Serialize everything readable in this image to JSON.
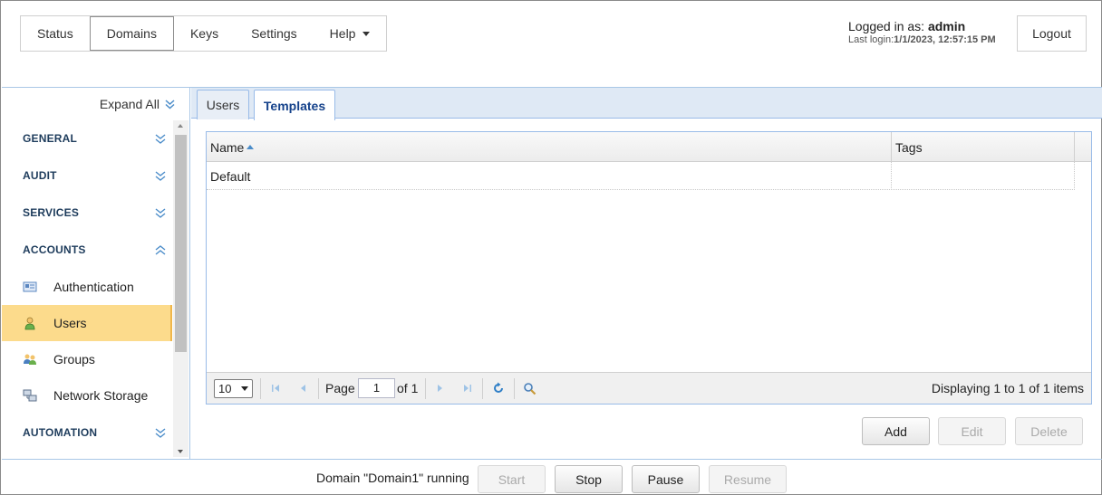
{
  "topnav": {
    "items": [
      {
        "label": "Status"
      },
      {
        "label": "Domains"
      },
      {
        "label": "Keys"
      },
      {
        "label": "Settings"
      },
      {
        "label": "Help"
      }
    ]
  },
  "login": {
    "prefix": "Logged in as: ",
    "user": "admin",
    "last_prefix": "Last login:",
    "last_value": "1/1/2023, 12:57:15 PM",
    "logout_label": "Logout"
  },
  "sidebar": {
    "expand_all": "Expand All",
    "sections": [
      {
        "label": "GENERAL",
        "state": "collapsed"
      },
      {
        "label": "AUDIT",
        "state": "collapsed"
      },
      {
        "label": "SERVICES",
        "state": "collapsed"
      },
      {
        "label": "ACCOUNTS",
        "state": "expanded"
      },
      {
        "label": "AUTOMATION",
        "state": "collapsed"
      }
    ],
    "items": [
      {
        "label": "Authentication",
        "icon": "authentication-icon"
      },
      {
        "label": "Users",
        "icon": "user-icon"
      },
      {
        "label": "Groups",
        "icon": "groups-icon"
      },
      {
        "label": "Network Storage",
        "icon": "network-storage-icon"
      }
    ]
  },
  "tabs": [
    {
      "label": "Users"
    },
    {
      "label": "Templates"
    }
  ],
  "grid": {
    "columns": [
      "Name",
      "Tags"
    ],
    "rows": [
      {
        "name": "Default",
        "tags": ""
      }
    ]
  },
  "pager": {
    "page_size": "10",
    "page_label": "Page",
    "page_value": "1",
    "of_label": "of 1",
    "display": "Displaying 1 to 1 of 1 items"
  },
  "actions": {
    "add": "Add",
    "edit": "Edit",
    "delete": "Delete"
  },
  "footer": {
    "status": "Domain \"Domain1\" running",
    "start": "Start",
    "stop": "Stop",
    "pause": "Pause",
    "resume": "Resume"
  },
  "colors": {
    "accent_blue": "#4a8cc9",
    "selected_bg": "#fcdb8c",
    "tab_text": "#15428b"
  }
}
